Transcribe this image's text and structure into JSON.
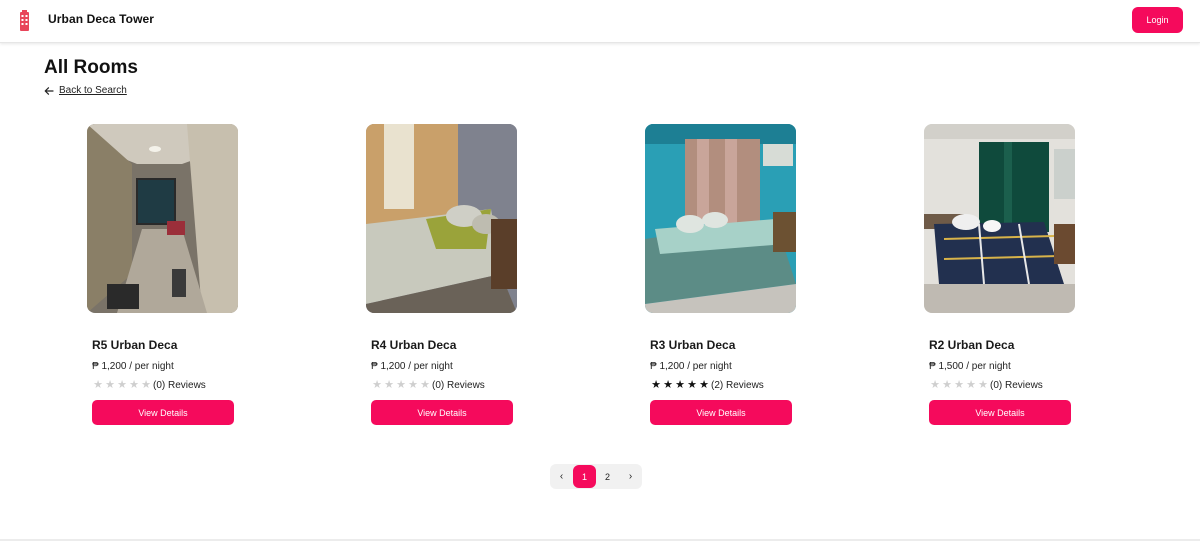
{
  "header": {
    "brand": "Urban Deca Tower",
    "login_label": "Login"
  },
  "page": {
    "title": "All Rooms",
    "back_label": "Back to Search"
  },
  "rooms": [
    {
      "name": "R5 Urban Deca",
      "price": "₱ 1,200 / per night",
      "stars": 0,
      "reviews": "(0) Reviews",
      "button": "View Details"
    },
    {
      "name": "R4 Urban Deca",
      "price": "₱ 1,200 / per night",
      "stars": 0,
      "reviews": "(0) Reviews",
      "button": "View Details"
    },
    {
      "name": "R3 Urban Deca",
      "price": "₱ 1,200 / per night",
      "stars": 5,
      "reviews": "(2) Reviews",
      "button": "View Details"
    },
    {
      "name": "R2 Urban Deca",
      "price": "₱ 1,500 / per night",
      "stars": 0,
      "reviews": "(0) Reviews",
      "button": "View Details"
    }
  ],
  "pagination": {
    "prev": "‹",
    "pages": [
      "1",
      "2"
    ],
    "current": "1",
    "next": "›"
  },
  "theme": {
    "accent": "#f50a5c"
  }
}
